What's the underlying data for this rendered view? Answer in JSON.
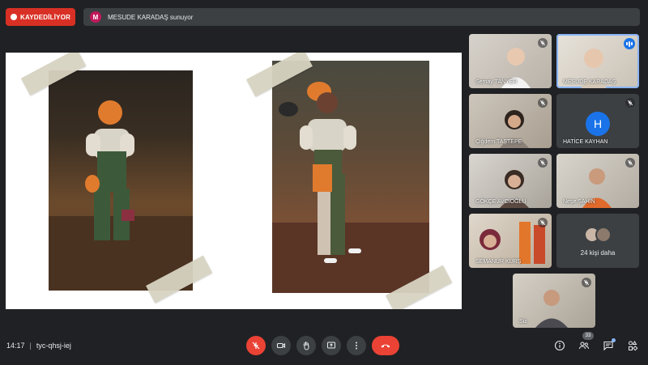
{
  "recording": {
    "label": "KAYDEDİLİYOR",
    "color": "#d93025"
  },
  "presenter": {
    "initial": "M",
    "text": "MESUDE KARADAŞ sunuyor"
  },
  "slide": {
    "background": "#ffffff"
  },
  "participants": [
    {
      "name": "Semay TANYER",
      "muted": true
    },
    {
      "name": "MESUDE KARADAŞ",
      "speaking": true
    },
    {
      "name": "Çiğdem TAŞTEPE",
      "muted": true
    },
    {
      "name": "HATİCE KAYHAN",
      "initial": "H",
      "muted": true
    },
    {
      "name": "GÖKÇE AVCIOĞLU",
      "muted": true
    },
    {
      "name": "Neşe ŞAHİN",
      "muted": true
    },
    {
      "name": "SEMANUR KURŞ",
      "muted": true
    },
    {
      "more_label": "24 kişi daha"
    },
    {
      "name": "Siz",
      "muted": true
    }
  ],
  "meeting": {
    "time": "14:17",
    "separator": "|",
    "code": "tyc-qhsj-iej"
  },
  "toolbar": {
    "mic": "mic-off-icon",
    "camera": "camera-icon",
    "raise_hand": "hand-icon",
    "present": "present-icon",
    "more": "more-vert-icon",
    "hangup": "hangup-icon"
  },
  "side_panel": {
    "people_count": "33"
  }
}
